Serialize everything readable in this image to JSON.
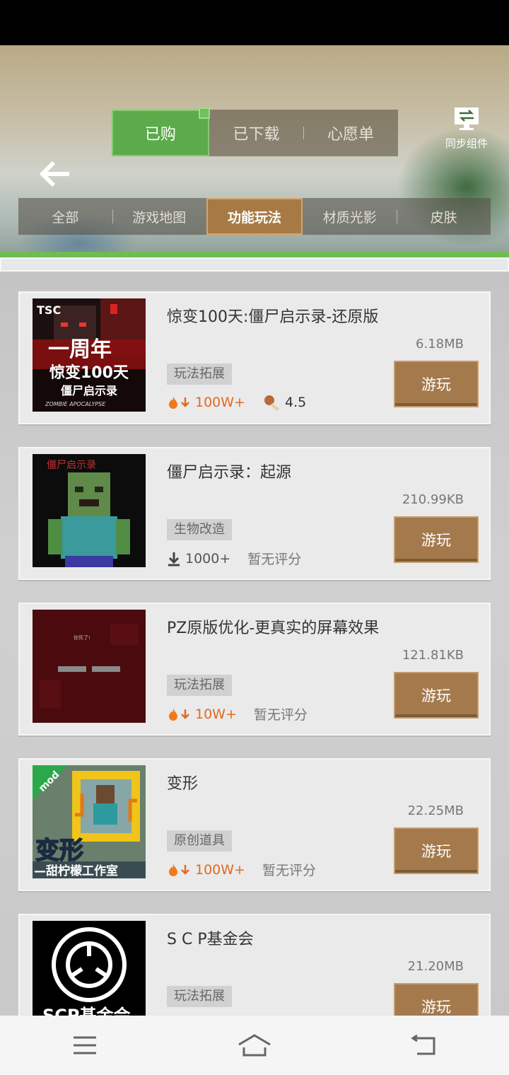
{
  "header": {
    "tabs": [
      {
        "label": "已购",
        "active": true
      },
      {
        "label": "已下载",
        "active": false
      },
      {
        "label": "心愿单",
        "active": false
      }
    ],
    "sync_label": "同步组件"
  },
  "sub_tabs": [
    {
      "label": "全部",
      "active": false
    },
    {
      "label": "游戏地图",
      "active": false
    },
    {
      "label": "功能玩法",
      "active": true
    },
    {
      "label": "材质光影",
      "active": false
    },
    {
      "label": "皮肤",
      "active": false
    }
  ],
  "items": [
    {
      "title": "惊变100天:僵尸启示录-还原版",
      "size": "6.18MB",
      "tag": "玩法拓展",
      "downloads": "100W+",
      "hot": true,
      "rating": "4.5",
      "button": "游玩",
      "thumb_text": {
        "brand": "TSC",
        "line1": "一周年",
        "line2": "惊变100天",
        "line3": "僵尸启示录",
        "line4": "ZOMBIE APOCALYPSE"
      }
    },
    {
      "title": "僵尸启示录：起源",
      "size": "210.99KB",
      "tag": "生物改造",
      "downloads": "1000+",
      "hot": false,
      "rating": "暂无评分",
      "button": "游玩",
      "thumb_text": {
        "line1": "僵尸启示录"
      }
    },
    {
      "title": "PZ原版优化-更真实的屏幕效果",
      "size": "121.81KB",
      "tag": "玩法拓展",
      "downloads": "10W+",
      "hot": true,
      "rating": "暂无评分",
      "button": "游玩",
      "thumb_text": {
        "line1": "你死了!"
      }
    },
    {
      "title": "变形",
      "size": "22.25MB",
      "tag": "原创道具",
      "downloads": "100W+",
      "hot": true,
      "rating": "暂无评分",
      "button": "游玩",
      "thumb_text": {
        "badge": "mod",
        "line1": "变形",
        "line2": "—甜柠檬工作室"
      }
    },
    {
      "title": "S C P基金会",
      "size": "21.20MB",
      "tag": "玩法拓展",
      "downloads": "",
      "hot": true,
      "rating": "",
      "button": "游玩",
      "thumb_text": {
        "line1": "SCP基金会"
      }
    }
  ],
  "colors": {
    "accent_green": "#5cab4b",
    "play_brown": "#a47a4d",
    "hot_orange": "#e46a1d"
  }
}
